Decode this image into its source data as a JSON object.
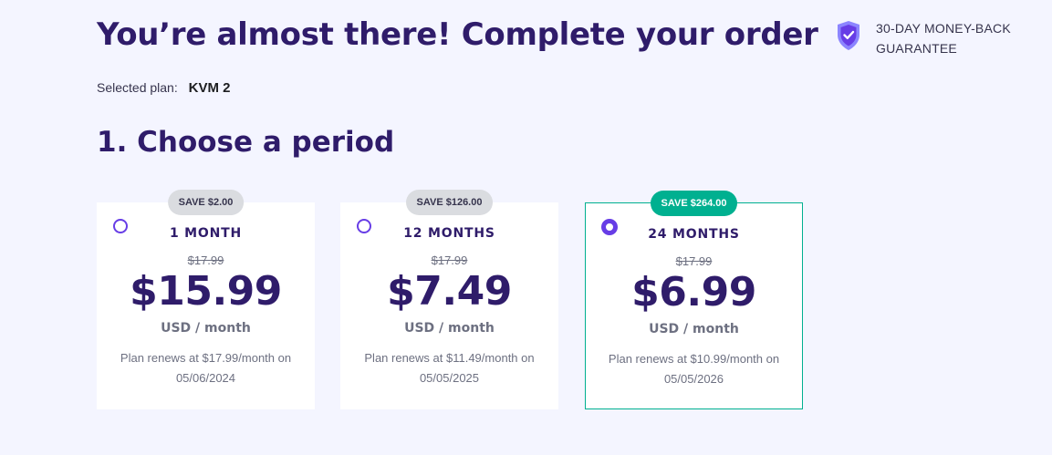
{
  "header": {
    "title": "You’re almost there! Complete your order",
    "guarantee_line1": "30-DAY MONEY-BACK",
    "guarantee_line2": "GUARANTEE",
    "guarantee_icon": "shield-check-icon"
  },
  "selected_plan": {
    "label": "Selected plan:",
    "value": "KVM 2"
  },
  "section": {
    "title": "1. Choose a period"
  },
  "periods": [
    {
      "badge": "SAVE $2.00",
      "label": "1 MONTH",
      "old_price": "$17.99",
      "price": "$15.99",
      "unit": "USD / month",
      "renew": "Plan renews at $17.99/month on 05/06/2024",
      "selected": false
    },
    {
      "badge": "SAVE $126.00",
      "label": "12 MONTHS",
      "old_price": "$17.99",
      "price": "$7.49",
      "unit": "USD / month",
      "renew": "Plan renews at $11.49/month on 05/05/2025",
      "selected": false
    },
    {
      "badge": "SAVE $264.00",
      "label": "24 MONTHS",
      "old_price": "$17.99",
      "price": "$6.99",
      "unit": "USD / month",
      "renew": "Plan renews at $10.99/month on 05/05/2026",
      "selected": true
    }
  ],
  "colors": {
    "background": "#f4f5ff",
    "primary_text": "#2f1c6a",
    "accent_purple": "#673de6",
    "accent_green": "#00b090",
    "badge_gray": "#dadce0"
  }
}
